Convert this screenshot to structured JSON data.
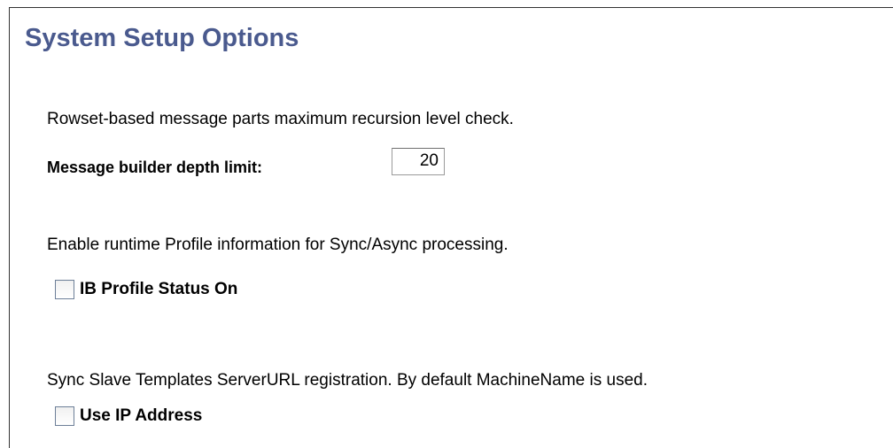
{
  "page": {
    "title": "System Setup Options"
  },
  "recursion_section": {
    "description": "Rowset-based message parts maximum recursion level check.",
    "depth_limit_label": "Message builder depth limit:",
    "depth_limit_value": "20"
  },
  "profile_section": {
    "description": "Enable runtime Profile information for Sync/Async processing.",
    "checkbox_label": "IB Profile Status On",
    "checked": false
  },
  "sync_section": {
    "description": "Sync Slave Templates ServerURL registration. By default MachineName is used.",
    "checkbox_label": "Use IP Address",
    "checked": false
  },
  "colors": {
    "title": "#4a5a8e",
    "checkbox_border": "#6d7f98",
    "frame_border": "#333333"
  }
}
